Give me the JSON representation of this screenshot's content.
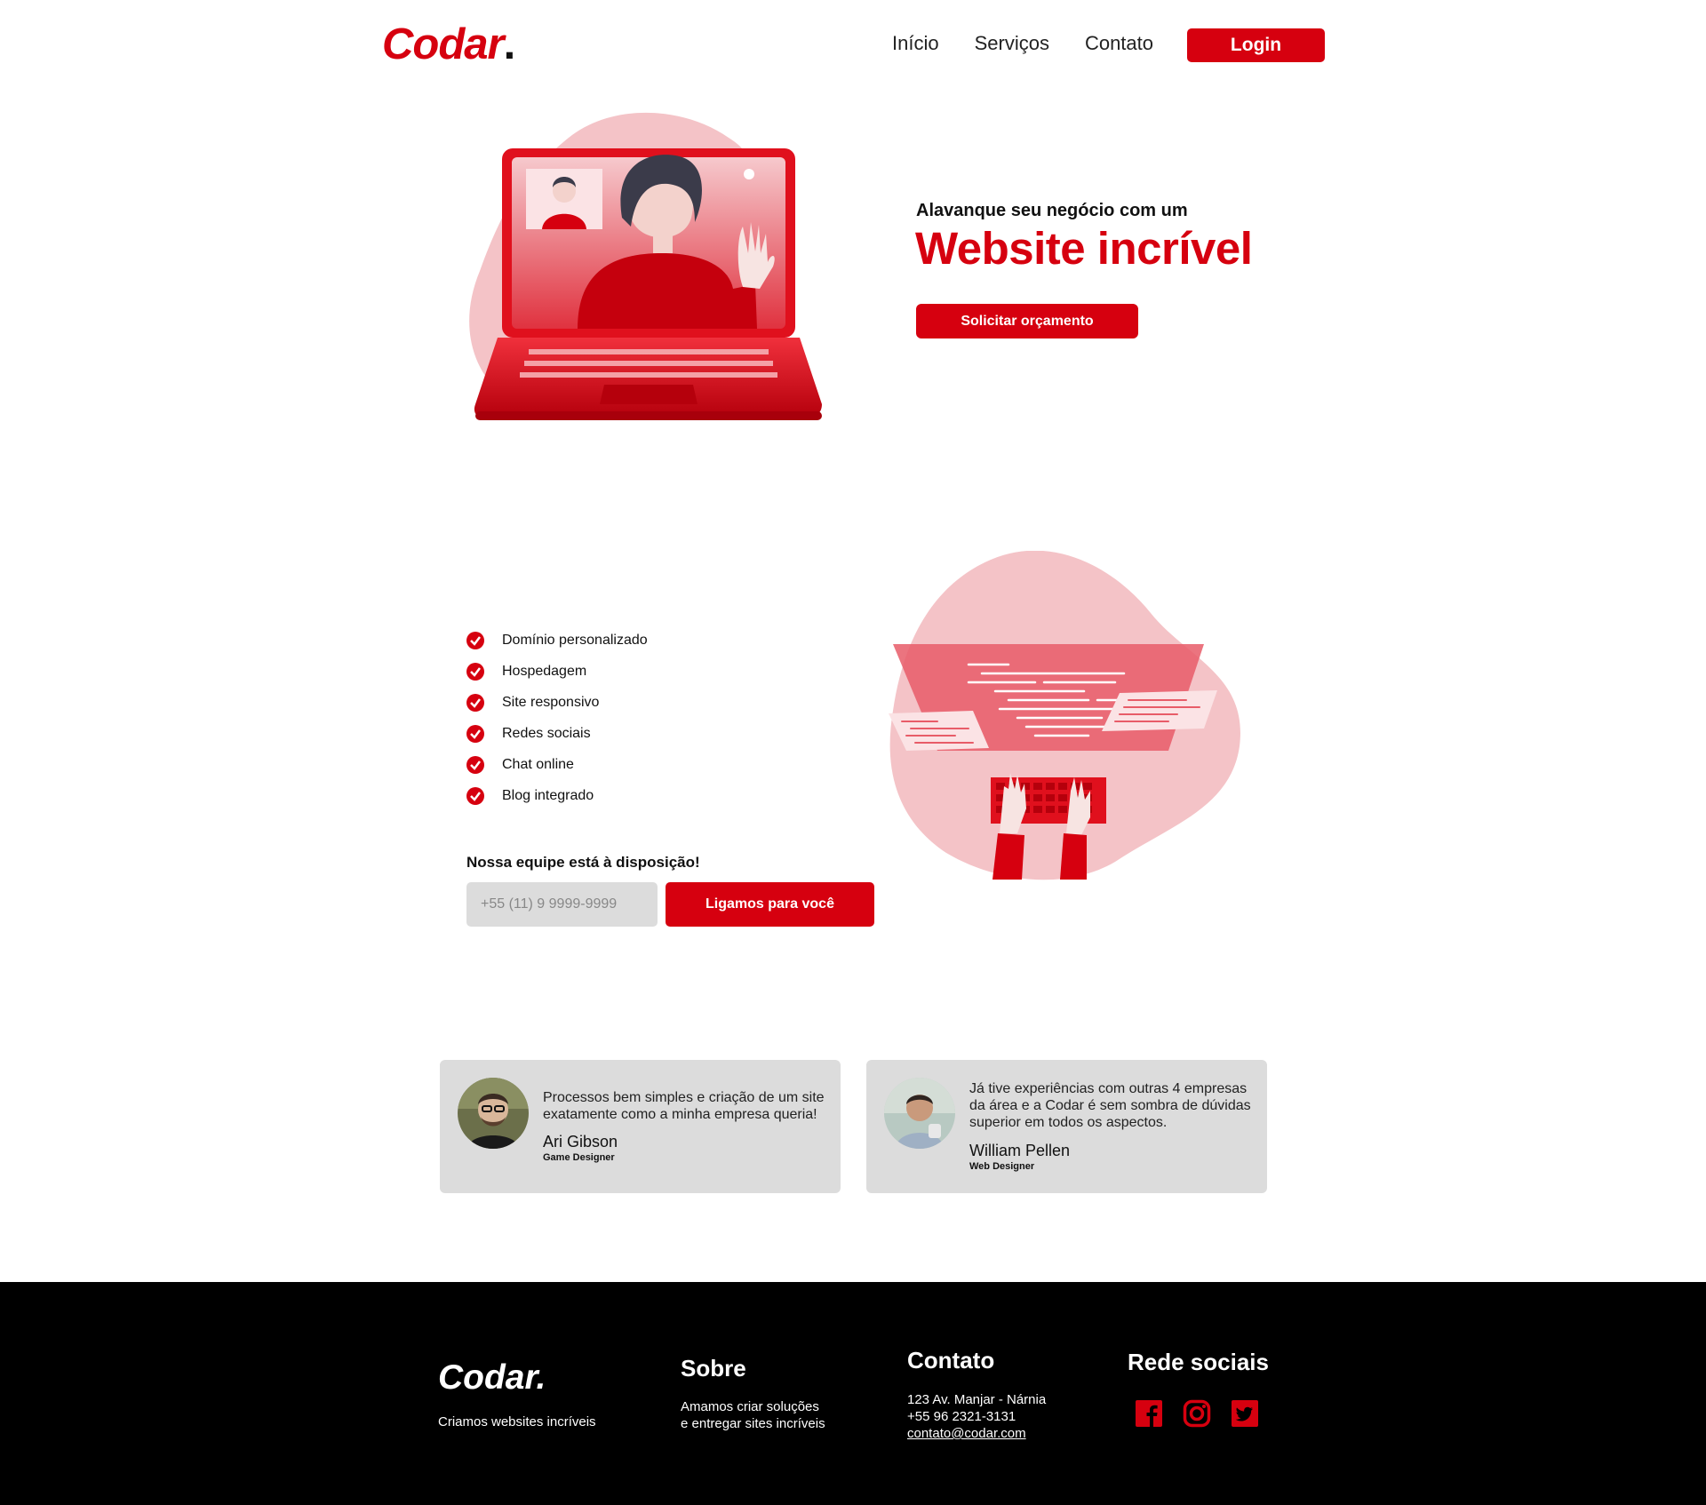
{
  "header": {
    "logo_text": "Codar",
    "logo_dot": ".",
    "nav": [
      "Início",
      "Serviços",
      "Contato"
    ],
    "login_label": "Login"
  },
  "hero": {
    "subtitle": "Alavanque seu negócio com um",
    "title": "Website incrível",
    "cta_label": "Solicitar orçamento"
  },
  "features": {
    "items": [
      "Domínio personalizado",
      "Hospedagem",
      "Site responsivo",
      "Redes sociais",
      "Chat online",
      "Blog integrado"
    ],
    "team_text": "Nossa equipe está à disposição!",
    "phone_placeholder": "+55 (11) 9 9999-9999",
    "call_label": "Ligamos para você"
  },
  "testimonials": [
    {
      "text": "Processos bem simples e criação de um site exatamente como a minha empresa queria!",
      "name": "Ari Gibson",
      "role": "Game Designer"
    },
    {
      "text": "Já tive experiências com outras 4 empresas da área e a Codar é sem sombra de dúvidas superior em todos os aspectos.",
      "name": "William Pellen",
      "role": "Web Designer"
    }
  ],
  "footer": {
    "logo": "Codar.",
    "tagline": "Criamos websites incríveis",
    "about_title": "Sobre",
    "about_line1": "Amamos criar soluções",
    "about_line2": "e entregar sites incríveis",
    "contact_title": "Contato",
    "address": "123 Av. Manjar - Nárnia",
    "phone": "+55 96 2321-3131",
    "email": "contato@codar.com",
    "social_title": "Rede sociais",
    "social_icons": [
      "facebook-icon",
      "instagram-icon",
      "twitter-icon"
    ]
  },
  "colors": {
    "brand_red": "#d6000f",
    "pink_blob": "#f4c3c7",
    "card_gray": "#dcdcdc",
    "footer_bg": "#000000"
  }
}
